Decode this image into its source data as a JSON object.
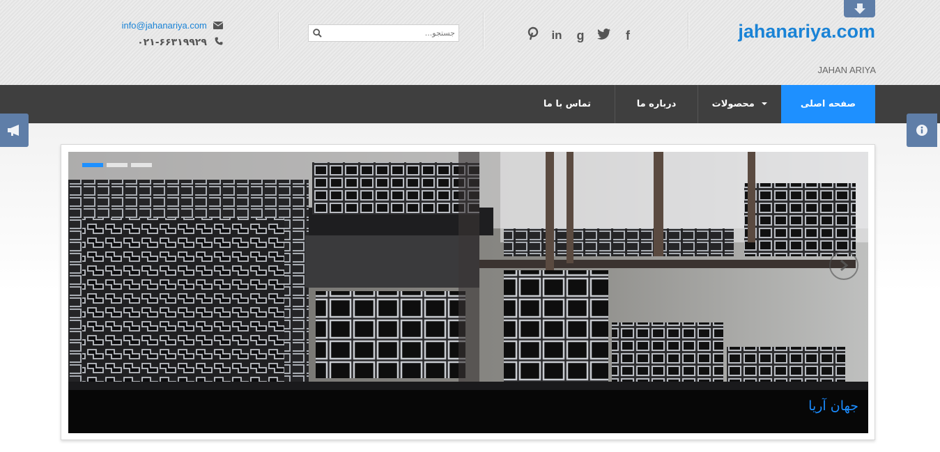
{
  "header": {
    "logo": "jahanariya.com",
    "tagline": "JAHAN ARIYA",
    "email": "info@jahanariya.com",
    "phone": "۰۲۱-۶۶۳۱۹۹۲۹",
    "search_placeholder": "جستجو...",
    "social": [
      {
        "icon": "facebook-icon",
        "glyph": "f"
      },
      {
        "icon": "twitter-icon",
        "glyph": "🐦"
      },
      {
        "icon": "google-icon",
        "glyph": "g"
      },
      {
        "icon": "linkedin-icon",
        "glyph": "in"
      },
      {
        "icon": "pinterest-icon",
        "glyph": "P"
      }
    ]
  },
  "nav": {
    "items": [
      "صفحه اصلی",
      "محصولات",
      "درباره ما",
      "تماس با ما"
    ],
    "active_index": 0
  },
  "slider": {
    "caption": "جهان آریا",
    "slide_count": 3,
    "current": 0
  },
  "colors": {
    "accent": "#1e90ff",
    "nav_bg": "#3f3f3f",
    "side_button": "#5f7ea8",
    "logo": "#1a83d6"
  }
}
